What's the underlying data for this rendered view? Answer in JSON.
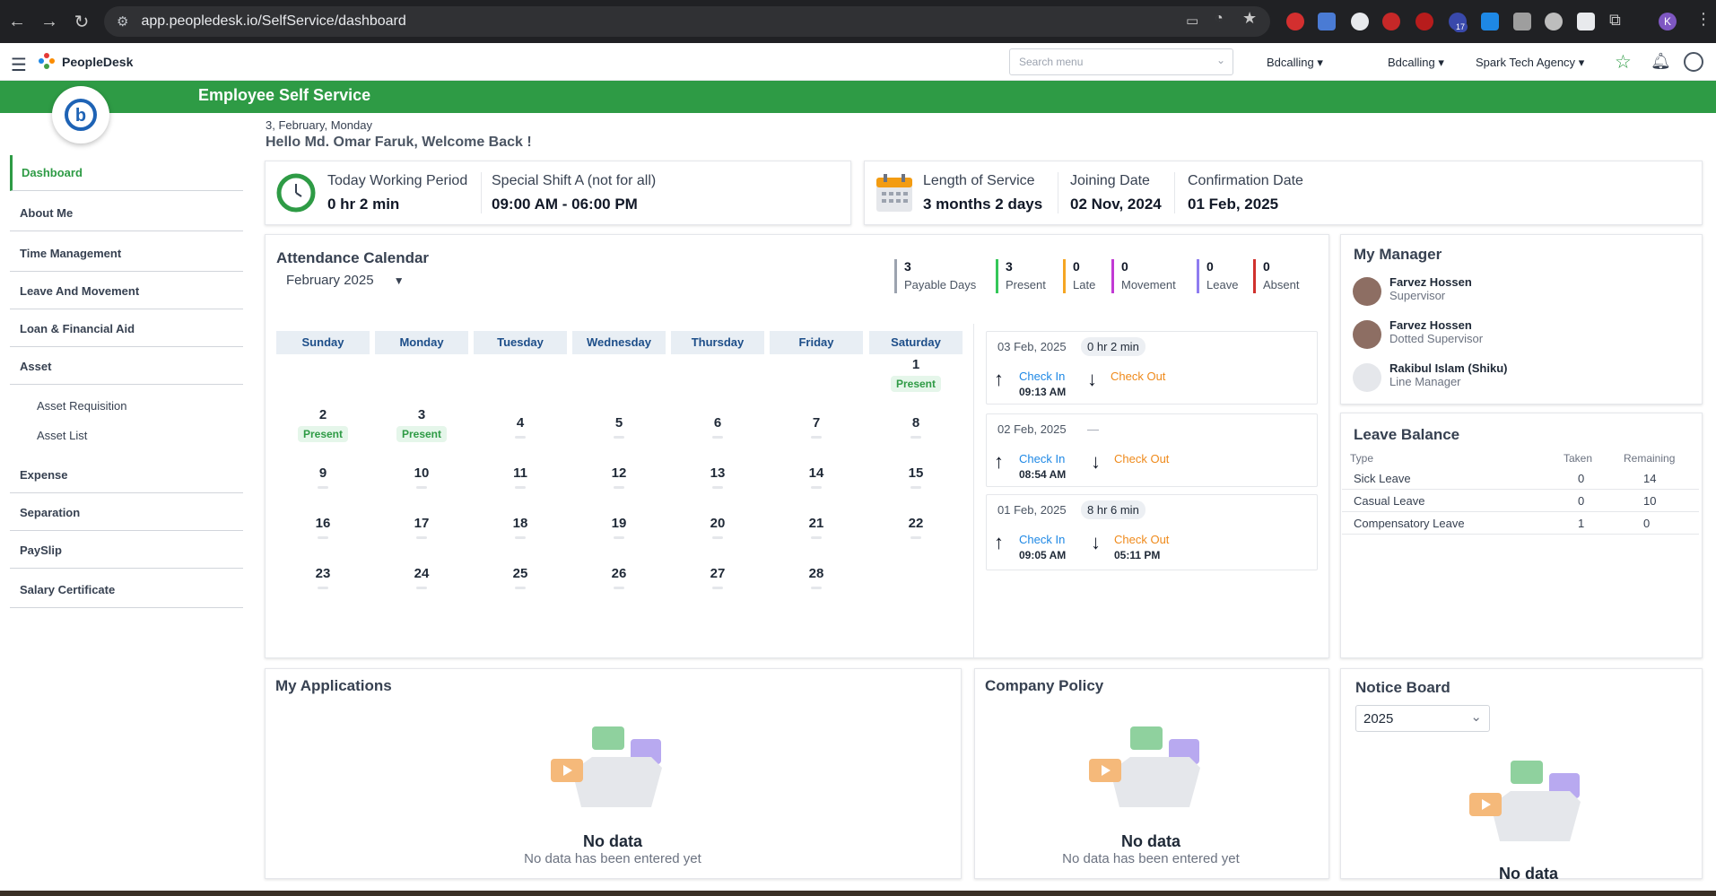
{
  "browser": {
    "url": "app.peopledesk.io/SelfService/dashboard",
    "profile_initial": "K",
    "ext_badge": "17"
  },
  "header": {
    "brand": "PeopleDesk",
    "search_placeholder": "Search menu",
    "dropdowns": [
      "Bdcalling",
      "Bdcalling",
      "Spark Tech Agency"
    ]
  },
  "banner": {
    "title": "Employee Self Service"
  },
  "greeting": {
    "date": "3, February, Monday",
    "welcome": "Hello Md. Omar Faruk, Welcome Back !"
  },
  "sidebar": {
    "items": [
      "Dashboard",
      "About Me",
      "Time Management",
      "Leave And Movement",
      "Loan & Financial Aid",
      "Asset"
    ],
    "asset_sub": [
      "Asset Requisition",
      "Asset List"
    ],
    "items2": [
      "Expense",
      "Separation",
      "PaySlip",
      "Salary Certificate"
    ]
  },
  "work": {
    "period_label": "Today Working Period",
    "period_value": "0 hr 2 min",
    "shift_label": "Special Shift A (not for all)",
    "shift_value": "09:00 AM - 06:00 PM"
  },
  "service": {
    "length_label": "Length of Service",
    "length_value": "3 months 2 days",
    "join_label": "Joining Date",
    "join_value": "02 Nov, 2024",
    "confirm_label": "Confirmation Date",
    "confirm_value": "01 Feb, 2025"
  },
  "calendar": {
    "title": "Attendance Calendar",
    "month": "February",
    "year": "2025",
    "days_of_week": [
      "Sunday",
      "Monday",
      "Tuesday",
      "Wednesday",
      "Thursday",
      "Friday",
      "Saturday"
    ],
    "present_label": "Present",
    "stats": [
      {
        "value": "3",
        "label": "Payable Days",
        "color": "#9ca3af"
      },
      {
        "value": "3",
        "label": "Present",
        "color": "#34c759"
      },
      {
        "value": "0",
        "label": "Late",
        "color": "#f5a623"
      },
      {
        "value": "0",
        "label": "Movement",
        "color": "#c13ad4"
      },
      {
        "value": "0",
        "label": "Leave",
        "color": "#8e7cf0"
      },
      {
        "value": "0",
        "label": "Absent",
        "color": "#d0312d"
      }
    ]
  },
  "attendance_log": [
    {
      "date": "03 Feb, 2025",
      "duration": "0 hr 2 min",
      "check_in": "Check In",
      "in_time": "09:13 AM",
      "check_out": "Check Out",
      "out_time": ""
    },
    {
      "date": "02 Feb, 2025",
      "duration": "—",
      "check_in": "Check In",
      "in_time": "08:54 AM",
      "check_out": "Check Out",
      "out_time": ""
    },
    {
      "date": "01 Feb, 2025",
      "duration": "8 hr 6 min",
      "check_in": "Check In",
      "in_time": "09:05 AM",
      "check_out": "Check Out",
      "out_time": "05:11 PM"
    }
  ],
  "manager": {
    "title": "My Manager",
    "people": [
      {
        "name": "Farvez Hossen",
        "role": "Supervisor"
      },
      {
        "name": "Farvez Hossen",
        "role": "Dotted Supervisor"
      },
      {
        "name": "Rakibul Islam (Shiku)",
        "role": "Line Manager"
      }
    ]
  },
  "leave_balance": {
    "title": "Leave Balance",
    "headers": [
      "Type",
      "Taken",
      "Remaining"
    ],
    "rows": [
      [
        "Sick Leave",
        "0",
        "14"
      ],
      [
        "Casual Leave",
        "0",
        "10"
      ],
      [
        "Compensatory Leave",
        "1",
        "0"
      ]
    ]
  },
  "applications": {
    "title": "My Applications",
    "empty_title": "No data",
    "empty_sub": "No data has been entered yet"
  },
  "policy": {
    "title": "Company Policy",
    "empty_title": "No data",
    "empty_sub": "No data has been entered yet"
  },
  "notice": {
    "title": "Notice Board",
    "year": "2025",
    "empty_title": "No data"
  }
}
